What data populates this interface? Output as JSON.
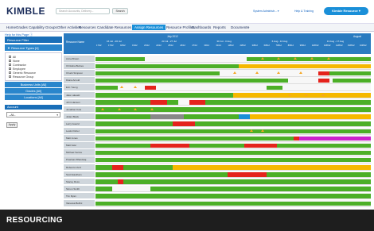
{
  "app": {
    "logo_main": "KIMBLE",
    "search_placeholder": "Search Accounts, Delivery...",
    "search_button": "Search",
    "system_admin": "System Administr... ▾",
    "help": "Help & Training",
    "resource_btn": "Kimble Resource ▾"
  },
  "nav": [
    "Home",
    "Grades",
    "Capability Groups",
    "Other Activities",
    "Resources",
    "Candidate Resources",
    "Assign Resources",
    "Resource Profiles",
    "Dashboards",
    "Reports",
    "Documents",
    "+"
  ],
  "nav_active": 6,
  "sidebar": {
    "help_link": "Help for this Page ⓘ",
    "resource_filter": "Resource Filter",
    "resource_types_header": "▼ Resource Types [4]",
    "types": [
      {
        "label": "All",
        "checked": false
      },
      {
        "label": "None",
        "checked": false
      },
      {
        "label": "Contractor",
        "checked": false
      },
      {
        "label": "Employee",
        "checked": true
      },
      {
        "label": "Generic Resource",
        "checked": false
      },
      {
        "label": "Resource Group",
        "checked": false
      }
    ],
    "sections": [
      "Business Units [All]",
      "Grades [All]",
      "Locations [All]"
    ],
    "account_label": "Account",
    "account_value": "--All--",
    "apply": "Apply"
  },
  "grid": {
    "col_header": "Resource Name",
    "months": [
      "July 2012",
      "August"
    ],
    "weeks": [
      "16 Jul - 20 Jul",
      "23 Jul - 27 Jul",
      "30 Jul - 3 Aug",
      "6 Aug - 10 Aug",
      "13 Aug - 17 Aug"
    ],
    "days": [
      "17/12",
      "17/12",
      "18/12",
      "19/12",
      "23/12",
      "24/12",
      "25/12",
      "26/12",
      "27/12",
      "30/12",
      "31/12",
      "1/8/12",
      "2/8/12",
      "3/8/12",
      "6/8/12",
      "7/8/12",
      "8/8/12",
      "9/8/12",
      "10/8/12",
      "13/8/12",
      "14/8/12",
      "15/8/12",
      "16/8/12"
    ],
    "rows": [
      {
        "name": "Anna Brown",
        "bars": [
          [
            "#4caf27",
            0,
            0.18
          ],
          [
            "#4caf27",
            0.55,
            1
          ]
        ],
        "tris": [
          0.6,
          0.66,
          0.72,
          0.78,
          0.84
        ]
      },
      {
        "name": "Christina Burkes",
        "bars": [
          [
            "#4caf27",
            0,
            0.52
          ],
          [
            "#f5b800",
            0.52,
            1
          ]
        ],
        "tris": []
      },
      {
        "name": "Chuck Simpson",
        "bars": [
          [
            "#4caf27",
            0,
            0.45
          ],
          [
            "#e4231c",
            0.81,
            0.85
          ],
          [
            "#4caf27",
            0.85,
            1
          ]
        ],
        "tris": [
          0.5,
          0.58,
          0.66,
          0.74
        ]
      },
      {
        "name": "Diana Arnold",
        "bars": [
          [
            "#4caf27",
            0,
            0.7
          ],
          [
            "#e4231c",
            0.81,
            0.85
          ],
          [
            "#4caf27",
            0.86,
            1
          ]
        ],
        "tris": []
      },
      {
        "name": "Erin Young",
        "bars": [
          [
            "#4caf27",
            0,
            0.08
          ],
          [
            "#e4231c",
            0.18,
            0.22
          ],
          [
            "#4caf27",
            0.62,
            0.68
          ]
        ],
        "tris": [
          0.09,
          0.14
        ]
      },
      {
        "name": "Jake Lakeski",
        "bars": [
          [
            "#4caf27",
            0,
            0.5
          ],
          [
            "#f5b800",
            0.5,
            1
          ]
        ],
        "tris": [
          0.7,
          0.76,
          0.82
        ]
      },
      {
        "name": "John Hanson",
        "bars": [
          [
            "#4caf27",
            0,
            0.2
          ],
          [
            "#e4231c",
            0.2,
            0.26
          ],
          [
            "#4caf27",
            0.26,
            0.3
          ],
          [
            "#e4231c",
            0.34,
            0.4
          ],
          [
            "#4caf27",
            0.4,
            1
          ]
        ],
        "tris": []
      },
      {
        "name": "Jonathan Kole",
        "bars": [
          [
            "#4caf27",
            0,
            1
          ]
        ],
        "tris": [
          0.02,
          0.08,
          0.14,
          0.2
        ]
      },
      {
        "name": "Julian Black",
        "bars": [
          [
            "#4caf27",
            0,
            0.2
          ],
          [
            "#888888",
            0.2,
            0.32
          ],
          [
            "#4caf27",
            0.32,
            0.52
          ],
          [
            "#1a8fd8",
            0.52,
            0.56
          ],
          [
            "#f5b800",
            0.56,
            1
          ]
        ],
        "tris": []
      },
      {
        "name": "Larry Goazd",
        "bars": [
          [
            "#4caf27",
            0,
            0.28
          ],
          [
            "#e4231c",
            0.28,
            0.36
          ],
          [
            "#4caf27",
            0.36,
            1
          ]
        ],
        "tris": []
      },
      {
        "name": "Lewis Fisher",
        "bars": [
          [
            "#4caf27",
            0,
            1
          ]
        ],
        "tris": [
          0.56,
          0.6
        ]
      },
      {
        "name": "Matt Jones",
        "bars": [
          [
            "#4caf27",
            0,
            0.72
          ],
          [
            "#e4231c",
            0.72,
            0.74
          ],
          [
            "#cc22cc",
            0.74,
            1
          ]
        ],
        "tris": []
      },
      {
        "name": "Matt Gavi",
        "bars": [
          [
            "#4caf27",
            0,
            0.2
          ],
          [
            "#e4231c",
            0.2,
            0.34
          ],
          [
            "#4caf27",
            0.34,
            0.54
          ],
          [
            "#e4231c",
            0.54,
            0.66
          ],
          [
            "#4caf27",
            0.66,
            1
          ]
        ],
        "tris": []
      },
      {
        "name": "Michael Venice",
        "bars": [
          [
            "#4caf27",
            0,
            1
          ]
        ],
        "tris": []
      },
      {
        "name": "Prashant Bhardwaj",
        "bars": [
          [
            "#4caf27",
            0,
            1
          ]
        ],
        "tris": []
      },
      {
        "name": "Rebecca Verd",
        "bars": [
          [
            "#4caf27",
            0,
            0.06
          ],
          [
            "#e4231c",
            0.06,
            0.1
          ],
          [
            "#4caf27",
            0.1,
            0.28
          ],
          [
            "#f5b800",
            0.28,
            1
          ]
        ],
        "tris": []
      },
      {
        "name": "Scott Eastham",
        "bars": [
          [
            "#4caf27",
            0,
            0.48
          ],
          [
            "#e4231c",
            0.48,
            0.62
          ],
          [
            "#4caf27",
            0.62,
            1
          ]
        ],
        "tris": []
      },
      {
        "name": "Stacey Ross",
        "bars": [
          [
            "#4caf27",
            0,
            0.08
          ],
          [
            "#e4231c",
            0.08,
            0.1
          ],
          [
            "#4caf27",
            0.1,
            1
          ]
        ],
        "tris": []
      },
      {
        "name": "Simon Smith",
        "bars": [
          [
            "#4caf27",
            0,
            0.06
          ],
          [
            "#4caf27",
            0.2,
            1
          ]
        ],
        "tris": []
      },
      {
        "name": "Tim Ryan",
        "bars": [
          [
            "#4caf27",
            0,
            1
          ]
        ],
        "tris": []
      },
      {
        "name": "Vanessa Bellini",
        "bars": [
          [
            "#4caf27",
            0,
            1
          ]
        ],
        "tris": []
      }
    ]
  },
  "caption": "RESOURCING"
}
